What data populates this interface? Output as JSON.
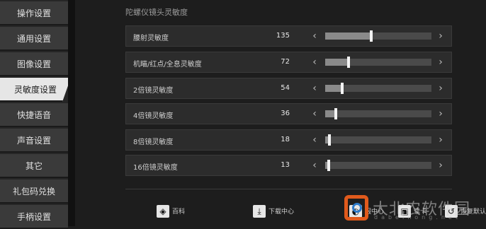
{
  "sidebar": {
    "items": [
      {
        "label": "操作设置"
      },
      {
        "label": "通用设置"
      },
      {
        "label": "图像设置"
      },
      {
        "label": "灵敏度设置",
        "active": true
      },
      {
        "label": "快捷语音"
      },
      {
        "label": "声音设置"
      },
      {
        "label": "其它"
      },
      {
        "label": "礼包码兑换"
      },
      {
        "label": "手柄设置"
      }
    ]
  },
  "section": {
    "title": "陀螺仪镜头灵敏度"
  },
  "sensitivity_rows": [
    {
      "label": "腰射灵敏度",
      "value": "135",
      "level": 0.43
    },
    {
      "label": "机瞄/红点/全息灵敏度",
      "value": "72",
      "level": 0.22
    },
    {
      "label": "2倍镜灵敏度",
      "value": "54",
      "level": 0.16
    },
    {
      "label": "4倍镜灵敏度",
      "value": "36",
      "level": 0.1
    },
    {
      "label": "8倍镜灵敏度",
      "value": "18",
      "level": 0.04
    },
    {
      "label": "16倍镜灵敏度",
      "value": "13",
      "level": 0.03
    }
  ],
  "arrows": {
    "left": "‹",
    "right": "›"
  },
  "bottom_bar": {
    "wiki_icon": "◈",
    "wiki_label": "百科",
    "download_icon": "⤓",
    "download_label": "下载中心",
    "service_icon": "◐",
    "service_label": "服中心",
    "card_icon": "▣",
    "card_label": "读卡",
    "reset_icon": "↺",
    "reset_label": "恢复默认"
  },
  "watermark": {
    "text": "大北农软件园",
    "sub": "dabeinong.net"
  }
}
